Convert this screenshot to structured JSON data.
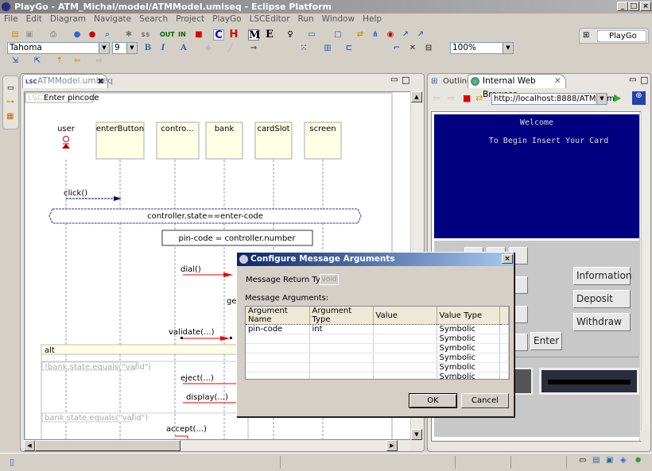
{
  "window": {
    "title": "PlayGo - ATM_Michal/model/ATMModel.umlseq - Eclipse Platform"
  },
  "menu": [
    "File",
    "Edit",
    "Diagram",
    "Navigate",
    "Search",
    "Project",
    "PlayGo",
    "LSCEditor",
    "Run",
    "Window",
    "Help"
  ],
  "toolbar": {
    "font_name": "Tahoma",
    "font_size": "9",
    "zoom": "100%",
    "perspective": "PlayGo",
    "labels": {
      "c": "C",
      "h": "H",
      "m": "M",
      "e": "E",
      "b": "B",
      "i": "I",
      "a": "A"
    }
  },
  "editor": {
    "tab": "ATMModel.umlseq",
    "lsc_prefix": "LSC",
    "lsc_name": "Enter pincode",
    "lifelines": [
      "user",
      "enterButton",
      "contro...",
      "bank",
      "cardSlot",
      "screen"
    ],
    "messages": {
      "click": "click()",
      "dial": "dial()",
      "ge": "ge",
      "validate": "validate(...)",
      "eject": "eject(...)",
      "display": "display(...)",
      "accept": "accept(...)"
    },
    "condition": "controller.state==enter-code",
    "assignment": "pin-code = controller.number",
    "alt": {
      "label": "alt",
      "guard1": "!bank.state.equals(\"valid\")",
      "guard2": "bank.state.equals(\"valid\")"
    }
  },
  "right_panel": {
    "tabs": [
      "Outline",
      "Internal Web Browser"
    ],
    "url": "http://localhost:8888/ATM.html",
    "atm": {
      "welcome": "Welcome",
      "prompt": "To Begin Insert Your Card",
      "buttons": [
        "Information",
        "Deposit",
        "Withdraw"
      ],
      "enter": "Enter",
      "screen_color": "#000080"
    }
  },
  "dialog": {
    "title": "Configure Message Arguments",
    "return_type_label": "Message Return Type:",
    "return_type": "void",
    "args_label": "Message Arguments:",
    "columns": [
      "Argument Name",
      "Argument Type",
      "Value",
      "Value Type"
    ],
    "rows": [
      [
        "pin-code",
        "int",
        "",
        "Symbolic"
      ],
      [
        "",
        "",
        "",
        "Symbolic"
      ],
      [
        "",
        "",
        "",
        "Symbolic"
      ],
      [
        "",
        "",
        "",
        "Symbolic"
      ],
      [
        "",
        "",
        "",
        "Symbolic"
      ],
      [
        "",
        "",
        "",
        "Symbolic"
      ],
      [
        "",
        "",
        "",
        ""
      ]
    ],
    "ok": "OK",
    "cancel": "Cancel"
  }
}
